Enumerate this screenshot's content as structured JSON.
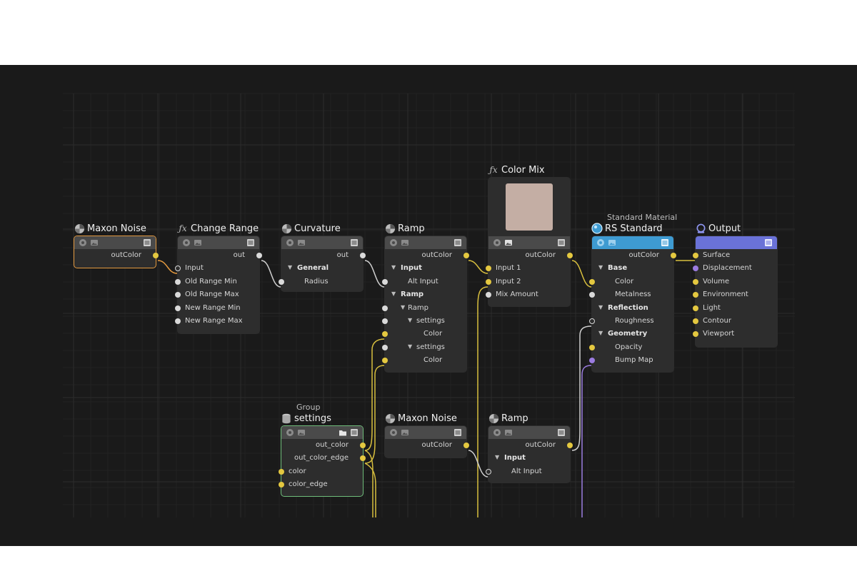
{
  "editor": {
    "background": "#1a1a1a",
    "accent_colors": {
      "selected_orange": "#e3993f",
      "selected_green": "#6fbd7a",
      "port_yellow": "#e4c840",
      "port_white": "#d9d9d9",
      "port_purple": "#9b7ce0",
      "header_blue": "#3e9bd2",
      "header_purple": "#6a72d8"
    }
  },
  "nodes": {
    "maxon_noise_1": {
      "title": "Maxon Noise",
      "icon": "noise-icon",
      "outputs": [
        "outColor"
      ]
    },
    "change_range": {
      "title": "Change Range",
      "icon": "fx-icon",
      "outputs": [
        "out"
      ],
      "inputs": [
        "Input",
        "Old Range Min",
        "Old Range Max",
        "New Range Min",
        "New Range Max"
      ]
    },
    "curvature": {
      "title": "Curvature",
      "icon": "noise-icon",
      "outputs": [
        "out"
      ],
      "group": "General",
      "inputs": [
        "Radius"
      ]
    },
    "ramp_1": {
      "title": "Ramp",
      "icon": "noise-icon",
      "outputs": [
        "outColor"
      ],
      "rows": [
        "Input",
        "Alt Input",
        "Ramp",
        "Ramp",
        "settings",
        "Color",
        "settings",
        "Color"
      ]
    },
    "color_mix": {
      "title": "Color Mix",
      "icon": "fx-icon",
      "swatch": "#c4aea4",
      "outputs": [
        "outColor"
      ],
      "inputs": [
        "Input 1",
        "Input 2",
        "Mix Amount"
      ]
    },
    "rs_standard": {
      "subtitle": "Standard Material",
      "title": "RS Standard",
      "icon": "material-icon",
      "outputs": [
        "outColor"
      ],
      "rows": [
        "Base",
        "Color",
        "Metalness",
        "Reflection",
        "Roughness",
        "Geometry",
        "Opacity",
        "Bump Map"
      ]
    },
    "output": {
      "title": "Output",
      "icon": "output-icon",
      "inputs": [
        "Surface",
        "Displacement",
        "Volume",
        "Environment",
        "Light",
        "Contour",
        "Viewport"
      ]
    },
    "group_settings": {
      "subtitle": "Group",
      "title": "settings",
      "icon": "group-icon",
      "outputs": [
        "out_color",
        "out_color_edge"
      ],
      "inputs": [
        "color",
        "color_edge"
      ]
    },
    "maxon_noise_2": {
      "title": "Maxon Noise",
      "icon": "noise-icon",
      "outputs": [
        "outColor"
      ]
    },
    "ramp_2": {
      "title": "Ramp",
      "icon": "noise-icon",
      "outputs": [
        "outColor"
      ],
      "group": "Input",
      "inputs": [
        "Alt Input"
      ]
    }
  }
}
